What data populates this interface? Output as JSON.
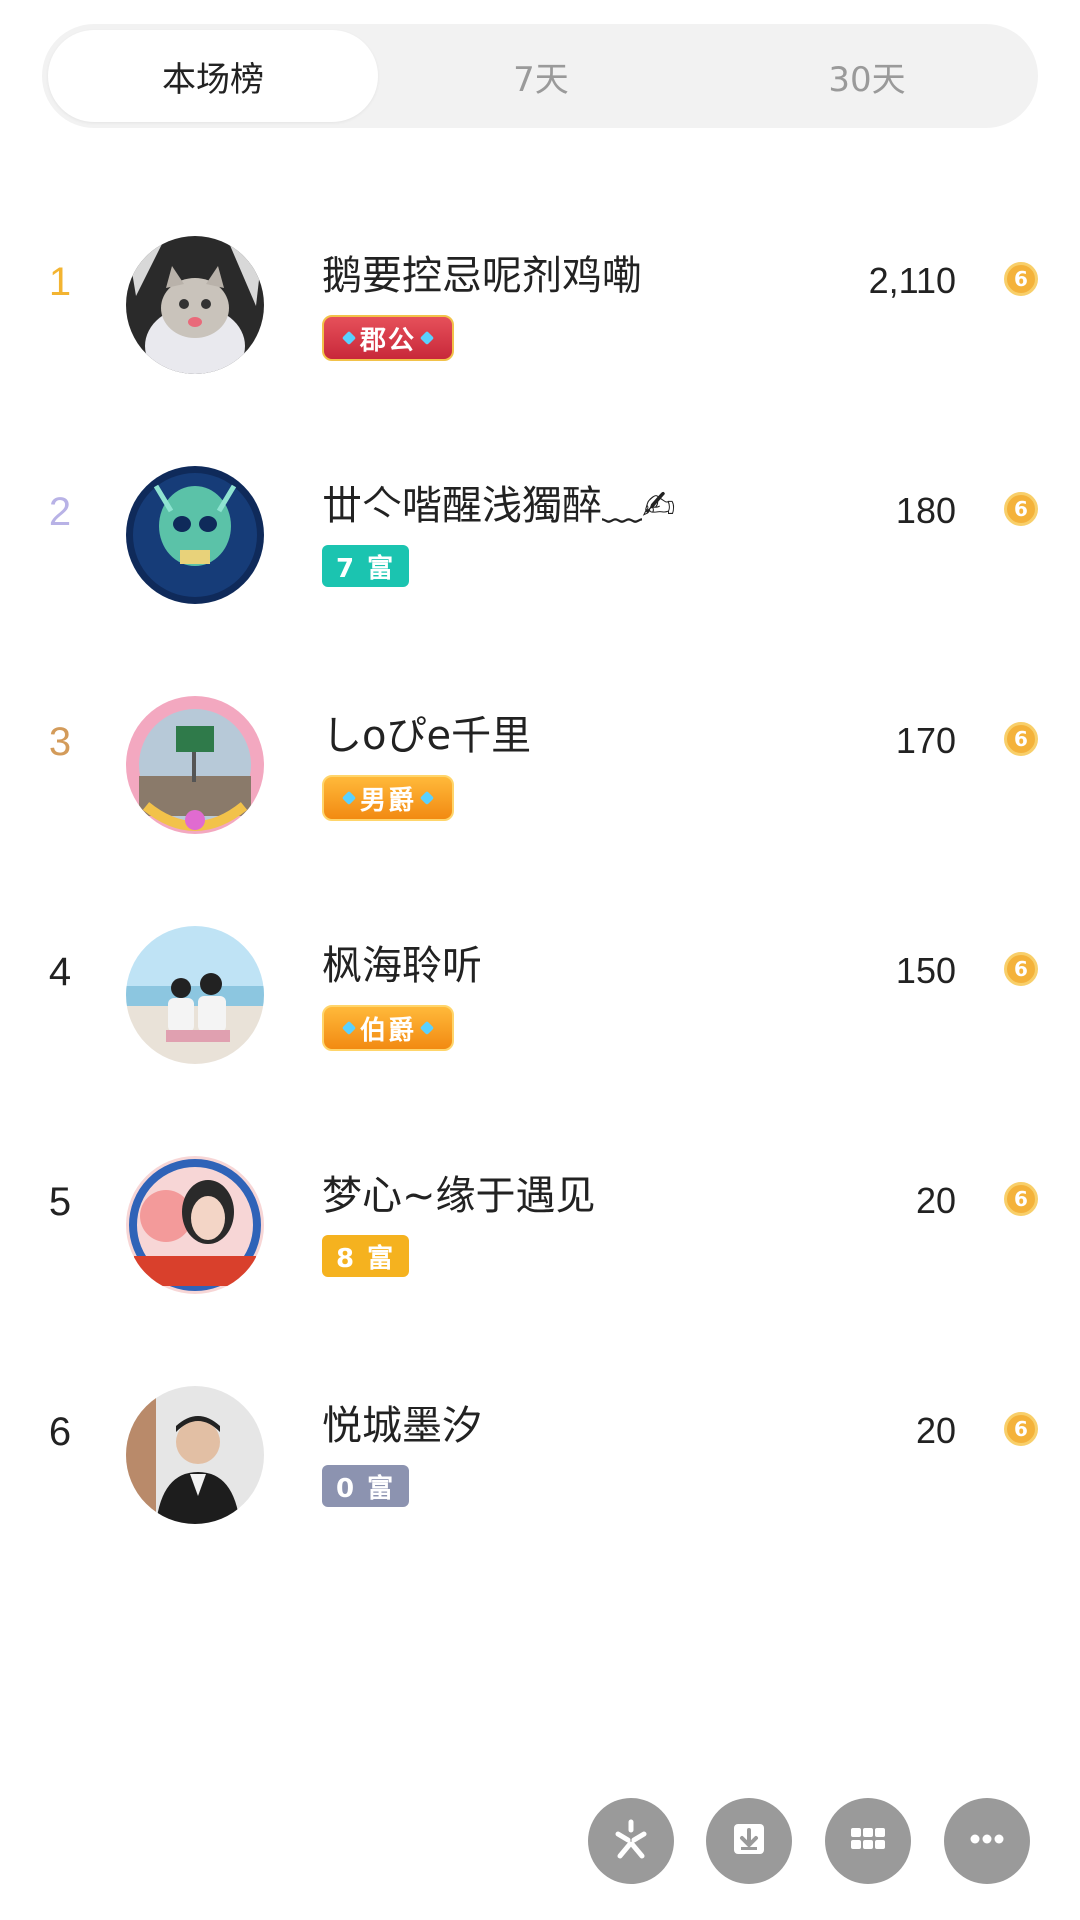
{
  "tabs": [
    {
      "label": "本场榜",
      "active": true
    },
    {
      "label": "7天",
      "active": false
    },
    {
      "label": "30天",
      "active": false
    }
  ],
  "ranking": [
    {
      "rank": "1",
      "name": "鹅要控忌呢剂鸡嘞",
      "badge": "郡公",
      "score": "2,110",
      "rank_color": "#f3b431"
    },
    {
      "rank": "2",
      "name": "丗亽喈醒浅獨醉﹏✍",
      "badge": "7 富",
      "score": "180",
      "rank_color": "#b8b2e6"
    },
    {
      "rank": "3",
      "name": "しoぴe千里",
      "badge": "男爵",
      "score": "170",
      "rank_color": "#d39b5a"
    },
    {
      "rank": "4",
      "name": "枫海聆听",
      "badge": "伯爵",
      "score": "150",
      "rank_color": "#222222"
    },
    {
      "rank": "5",
      "name": "梦心~缘于遇见",
      "badge": "8 富",
      "score": "20",
      "rank_color": "#222222"
    },
    {
      "rank": "6",
      "name": "悦城墨汐",
      "badge": "0 富",
      "score": "20",
      "rank_color": "#222222"
    }
  ],
  "coin_symbol": "6",
  "tools": [
    {
      "icon": "sparkle-icon"
    },
    {
      "icon": "download-icon"
    },
    {
      "icon": "grid-icon"
    },
    {
      "icon": "more-icon"
    }
  ]
}
